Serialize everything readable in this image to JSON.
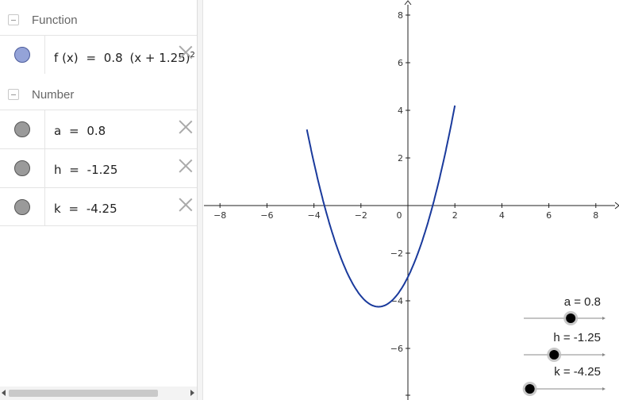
{
  "algebra": {
    "groups": [
      {
        "title": "Function"
      },
      {
        "title": "Number"
      }
    ],
    "function_item": {
      "name": "f",
      "arg": "(x)",
      "eq": "=",
      "expr_a": "0.8",
      "expr_paren": "(x + 1.25)",
      "expr_exp": "2",
      "expr_tail": "-",
      "color": "#94a3d8"
    },
    "numbers": [
      {
        "name": "a",
        "eq": "=",
        "value": "0.8"
      },
      {
        "name": "h",
        "eq": "=",
        "value": "-1.25"
      },
      {
        "name": "k",
        "eq": "=",
        "value": "-4.25"
      }
    ]
  },
  "graph": {
    "curve_color": "#1a3a9c",
    "x_ticks": [
      "−8",
      "−6",
      "−4",
      "−2",
      "0",
      "2",
      "4",
      "6",
      "8"
    ],
    "y_ticks_pos": [
      "8",
      "6",
      "4",
      "2"
    ],
    "y_ticks_neg": [
      "−2",
      "−4",
      "−6"
    ],
    "sliders": [
      {
        "label": "a = 0.8",
        "value": 0.8,
        "min": -5,
        "max": 5
      },
      {
        "label": "h = -1.25",
        "value": -1.25,
        "min": -5,
        "max": 5
      },
      {
        "label": "k = -4.25",
        "value": -4.25,
        "min": -5,
        "max": 5
      }
    ]
  }
}
